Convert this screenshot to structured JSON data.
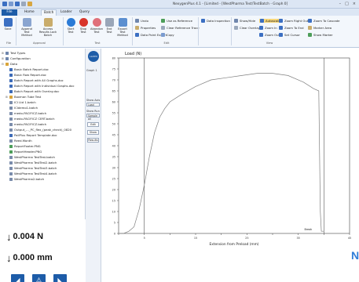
{
  "window": {
    "title": "NexygenPlus 4.1 - [Limited - [WestPharma Test/TestBatch - Graph 0]",
    "controls": [
      "–",
      "□",
      "×"
    ]
  },
  "ribbon": {
    "tabs": [
      "File",
      "Home",
      "Batch",
      "Loader",
      "Query"
    ],
    "active_tab": "Batch",
    "left_buttons": [
      {
        "label": "Save",
        "color": "#3b6fc2"
      },
      {
        "label": "Append Test Method",
        "color": "#8aa5d0"
      },
      {
        "label": "Access Results Lock Batch",
        "color": "#c9ac6b"
      }
    ],
    "test_buttons": [
      {
        "label": "Start Test",
        "color": "#2b7bd6"
      },
      {
        "label": "Stop Test",
        "color": "#d8352b"
      },
      {
        "label": "Abandon Test",
        "color": "#e0707a"
      },
      {
        "label": "End Test",
        "color": "#9aa6b8"
      },
      {
        "label": "Export Test Method",
        "color": "#5c8fd0"
      }
    ],
    "edit_items": [
      "Undo",
      "Use as Reference",
      "Properties",
      "Clear Reference Trace",
      "Data Point Export",
      "Copy"
    ],
    "data_inspection": "Data Inspection",
    "view_items": [
      "Show/Hide",
      "Autoscale",
      "Clear Overlays",
      "Zoom In",
      "Zoom Out",
      "Zoom Right Out",
      "Zoom To End",
      "Set Cursor"
    ],
    "view_items_right": [
      "Zoom To Cascade",
      "Marker Area",
      "Show Marker"
    ],
    "group_labels": [
      "File",
      "Approval",
      "Test",
      "Edit",
      "View"
    ]
  },
  "tree": {
    "items": [
      {
        "label": "Test Types",
        "indent": 1,
        "expand": "⊞",
        "color": "#6f86ad"
      },
      {
        "label": "Configuration",
        "indent": 1,
        "expand": "⊞",
        "color": "#6f86ad"
      },
      {
        "label": "Data",
        "indent": 1,
        "expand": "⊟",
        "color": "#d9a53a"
      },
      {
        "label": "Basic Batch Report.doc",
        "indent": 2,
        "expand": "",
        "color": "#3d6bb8"
      },
      {
        "label": "Basic Row Report.doc",
        "indent": 2,
        "expand": "",
        "color": "#3d6bb8"
      },
      {
        "label": "Batch Report with All Graphs.doc",
        "indent": 2,
        "expand": "",
        "color": "#3d6bb8"
      },
      {
        "label": "Batch Report with Individual Graphs.doc",
        "indent": 2,
        "expand": "",
        "color": "#3d6bb8"
      },
      {
        "label": "Batch Report with Overlay.doc",
        "indent": 2,
        "expand": "",
        "color": "#3d6bb8"
      },
      {
        "label": "Boxman Tube Test",
        "indent": 2,
        "expand": "⊞",
        "color": "#d9a53a"
      },
      {
        "label": "ICI Ltd 1.batch",
        "indent": 2,
        "expand": "",
        "color": "#7a8cab"
      },
      {
        "label": "ICIdemo1.batch",
        "indent": 2,
        "expand": "",
        "color": "#7a8cab"
      },
      {
        "label": "medo-PACIFICZ.batch",
        "indent": 2,
        "expand": "",
        "color": "#7a8cab"
      },
      {
        "label": "medo-PACIFICZ CERT.batch",
        "indent": 2,
        "expand": "",
        "color": "#7a8cab"
      },
      {
        "label": "medo-PACIFICZ.batch",
        "indent": 2,
        "expand": "",
        "color": "#7a8cab"
      },
      {
        "label": "Output_..._PC_flex_(peak_check)_0820",
        "indent": 2,
        "expand": "",
        "color": "#7a8cab"
      },
      {
        "label": "PaliPlus Report Template.doc",
        "indent": 2,
        "expand": "",
        "color": "#3d6bb8"
      },
      {
        "label": "Reed.Month",
        "indent": 2,
        "expand": "",
        "color": "#7a8cab"
      },
      {
        "label": "ReportFooter.PNG",
        "indent": 2,
        "expand": "",
        "color": "#4d9e5a"
      },
      {
        "label": "ReportHeader.PNG",
        "indent": 2,
        "expand": "",
        "color": "#4d9e5a"
      },
      {
        "label": "WestPharma TestTest.batch",
        "indent": 2,
        "expand": "",
        "color": "#7a8cab"
      },
      {
        "label": "WestPharma TestTest2.batch",
        "indent": 2,
        "expand": "",
        "color": "#7a8cab"
      },
      {
        "label": "WestPharma TestTest3.batch",
        "indent": 2,
        "expand": "",
        "color": "#7a8cab"
      },
      {
        "label": "WestPharma TestTest4.batch",
        "indent": 2,
        "expand": "",
        "color": "#7a8cab"
      },
      {
        "label": "WestPharma2.batch",
        "indent": 2,
        "expand": "",
        "color": "#7a8cab"
      }
    ]
  },
  "readouts": {
    "load": "0.004 N",
    "extension": "0.000 mm",
    "arrow": "↓"
  },
  "bottom_icons": [
    "◢",
    "⚠",
    "◣"
  ],
  "side_controls": {
    "logo": "LLOYD",
    "graph_label": "Graph 1",
    "show_axis_label": "Show Axis",
    "show_axis_value": "Load",
    "show_run_label": "Show Run",
    "show_run_value": "Sample all",
    "buttons": [
      "Edit",
      "Show",
      "Results"
    ]
  },
  "chart_data": {
    "type": "line",
    "title": "Load (N)",
    "xlabel": "Extension from Preload (mm)",
    "ylabel": "Load (N)",
    "xlim": [
      0,
      45
    ],
    "ylim": [
      0,
      80
    ],
    "xticks": [
      0,
      5,
      10,
      15,
      20,
      25,
      30,
      35,
      40,
      45
    ],
    "xtick_labels": [
      "",
      "5",
      "",
      "15",
      "",
      "25",
      "",
      "35",
      "",
      "45"
    ],
    "yticks": [
      0,
      5,
      10,
      15,
      20,
      25,
      30,
      35,
      40,
      45,
      50,
      55,
      60,
      65,
      70,
      75,
      80
    ],
    "ytick_labels": [
      "0",
      "5",
      "10",
      "15",
      "20",
      "25",
      "30",
      "35",
      "40",
      "45",
      "50",
      "55",
      "60",
      "65",
      "70",
      "75",
      "80"
    ],
    "series": [
      {
        "color": "#7f7f7f",
        "x": [
          0,
          1,
          2,
          3,
          4,
          5,
          6,
          7,
          8,
          9,
          10,
          12,
          15,
          18,
          21,
          24,
          27,
          30,
          33,
          36,
          38,
          39,
          39.3,
          39.5,
          40
        ],
        "y": [
          0,
          0,
          1,
          3,
          11,
          22,
          35,
          46,
          53,
          57,
          60,
          63,
          67,
          70,
          71,
          72,
          73,
          73,
          72,
          69,
          66,
          65,
          10,
          1,
          1
        ]
      }
    ],
    "annotations": [
      {
        "text": "Break",
        "x": 36.2,
        "y": 1.5
      }
    ],
    "marker_lines_x": [
      5,
      40
    ],
    "grid": false
  },
  "watermark": "N"
}
